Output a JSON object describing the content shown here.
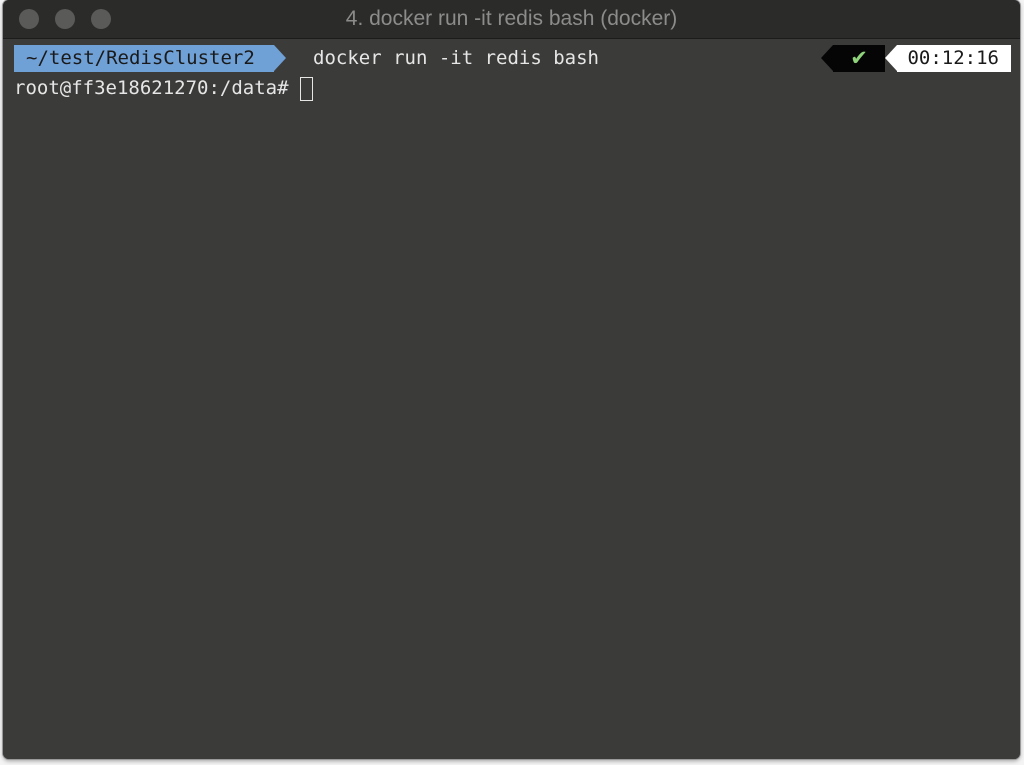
{
  "window": {
    "title": "4. docker run -it redis bash (docker)"
  },
  "prompt": {
    "path": "~/test/RedisCluster2",
    "command": "docker run -it redis bash",
    "status_icon": "✔",
    "elapsed": "00:12:16"
  },
  "shell": {
    "prompt_text": "root@ff3e18621270:/data#"
  },
  "colors": {
    "path_bg": "#6fa0d6",
    "status_bg": "#050505",
    "status_check": "#8fd37a",
    "terminal_bg": "#3b3b3a",
    "titlebar_bg": "#2b2b2a"
  }
}
